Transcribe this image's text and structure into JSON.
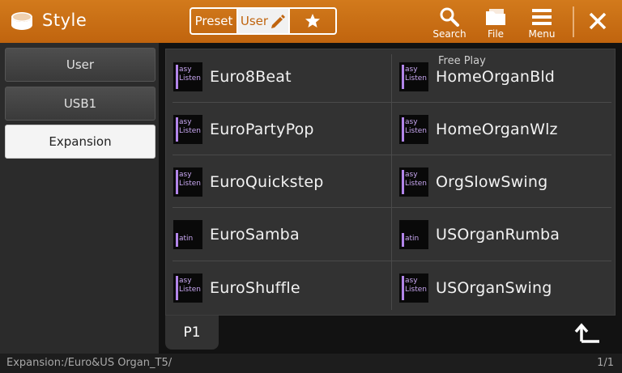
{
  "header": {
    "title": "Style",
    "app_icon": "style-drum-icon",
    "segments": [
      {
        "label": "Preset"
      },
      {
        "label": "User",
        "icon": "pencil-icon"
      },
      {
        "icon": "star-icon"
      }
    ],
    "search_label": "Search",
    "file_label": "File",
    "menu_label": "Menu",
    "close_icon": "close-icon"
  },
  "sidebar": {
    "items": [
      {
        "label": "User"
      },
      {
        "label": "USB1"
      },
      {
        "label": "Expansion",
        "active": true
      }
    ]
  },
  "styles": {
    "items": [
      {
        "name": "Euro8Beat",
        "badge": [
          "asy",
          "Listen"
        ]
      },
      {
        "name": "HomeOrganBld",
        "badge": [
          "asy",
          "Listen"
        ],
        "sub": "Free Play"
      },
      {
        "name": "EuroPartyPop",
        "badge": [
          "asy",
          "Listen"
        ]
      },
      {
        "name": "HomeOrganWlz",
        "badge": [
          "asy",
          "Listen"
        ]
      },
      {
        "name": "EuroQuickstep",
        "badge": [
          "asy",
          "Listen"
        ]
      },
      {
        "name": "OrgSlowSwing",
        "badge": [
          "asy",
          "Listen"
        ]
      },
      {
        "name": "EuroSamba",
        "badge": [
          "",
          "atin"
        ]
      },
      {
        "name": "USOrganRumba",
        "badge": [
          "",
          "atin"
        ]
      },
      {
        "name": "EuroShuffle",
        "badge": [
          "asy",
          "Listen"
        ]
      },
      {
        "name": "USOrganSwing",
        "badge": [
          "asy",
          "Listen"
        ]
      }
    ]
  },
  "page_tab": {
    "label": "P1"
  },
  "status": {
    "path": "Expansion:/Euro&US Organ_T5/",
    "page": "1/1"
  },
  "colors": {
    "accent": "#c8700f",
    "badge": "#b285ea"
  }
}
